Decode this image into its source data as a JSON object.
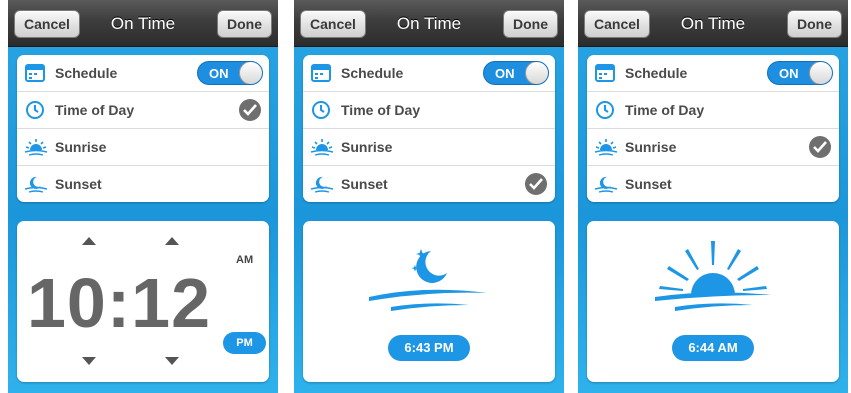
{
  "accent_color": "#1e96e6",
  "screens": [
    {
      "nav": {
        "title": "On Time",
        "cancel_label": "Cancel",
        "done_label": "Done"
      },
      "rows": [
        {
          "label": "Schedule",
          "icon": "calendar-icon"
        },
        {
          "label": "Time of Day",
          "icon": "clock-icon"
        },
        {
          "label": "Sunrise",
          "icon": "sunrise-icon"
        },
        {
          "label": "Sunset",
          "icon": "sunset-icon"
        }
      ],
      "schedule_toggle": "ON",
      "selected_row": "Time of Day",
      "time": {
        "display": "10:12",
        "am_label": "AM",
        "pm_label": "PM",
        "selected_period": "PM"
      }
    },
    {
      "nav": {
        "title": "On Time",
        "cancel_label": "Cancel",
        "done_label": "Done"
      },
      "rows": [
        {
          "label": "Schedule",
          "icon": "calendar-icon"
        },
        {
          "label": "Time of Day",
          "icon": "clock-icon"
        },
        {
          "label": "Sunrise",
          "icon": "sunrise-icon"
        },
        {
          "label": "Sunset",
          "icon": "sunset-icon"
        }
      ],
      "schedule_toggle": "ON",
      "selected_row": "Sunset",
      "time_label": "6:43 PM"
    },
    {
      "nav": {
        "title": "On Time",
        "cancel_label": "Cancel",
        "done_label": "Done"
      },
      "rows": [
        {
          "label": "Schedule",
          "icon": "calendar-icon"
        },
        {
          "label": "Time of Day",
          "icon": "clock-icon"
        },
        {
          "label": "Sunrise",
          "icon": "sunrise-icon"
        },
        {
          "label": "Sunset",
          "icon": "sunset-icon"
        }
      ],
      "schedule_toggle": "ON",
      "selected_row": "Sunrise",
      "time_label": "6:44 AM"
    }
  ]
}
